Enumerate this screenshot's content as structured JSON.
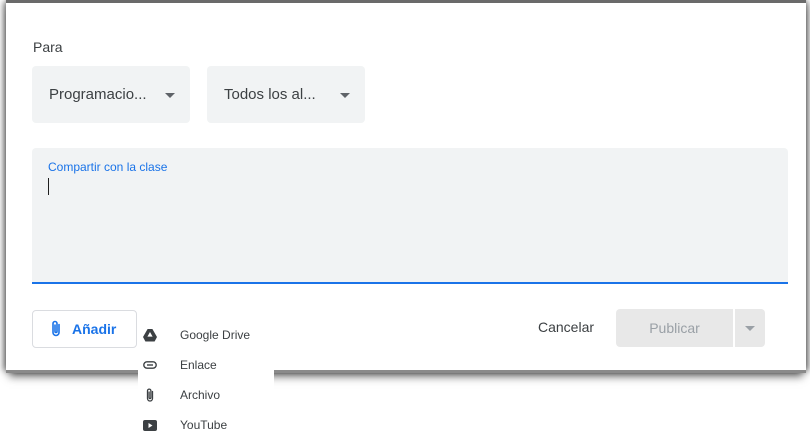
{
  "form": {
    "for_label": "Para",
    "class_select": {
      "value": "Programacio..."
    },
    "students_select": {
      "value": "Todos los al..."
    },
    "share": {
      "label": "Compartir con la clase"
    }
  },
  "actions": {
    "add_label": "Añadir",
    "cancel_label": "Cancelar",
    "publish_label": "Publicar"
  },
  "attach_menu": {
    "items": [
      {
        "label": "Google Drive",
        "icon": "google-drive-icon"
      },
      {
        "label": "Enlace",
        "icon": "link-icon"
      },
      {
        "label": "Archivo",
        "icon": "paperclip-icon"
      },
      {
        "label": "YouTube",
        "icon": "youtube-icon"
      }
    ]
  },
  "colors": {
    "accent": "#1a73e8",
    "field_bg": "#f1f3f4",
    "text": "#3c4043",
    "disabled_bg": "#e8e8e8",
    "disabled_text": "#9aa0a6"
  }
}
